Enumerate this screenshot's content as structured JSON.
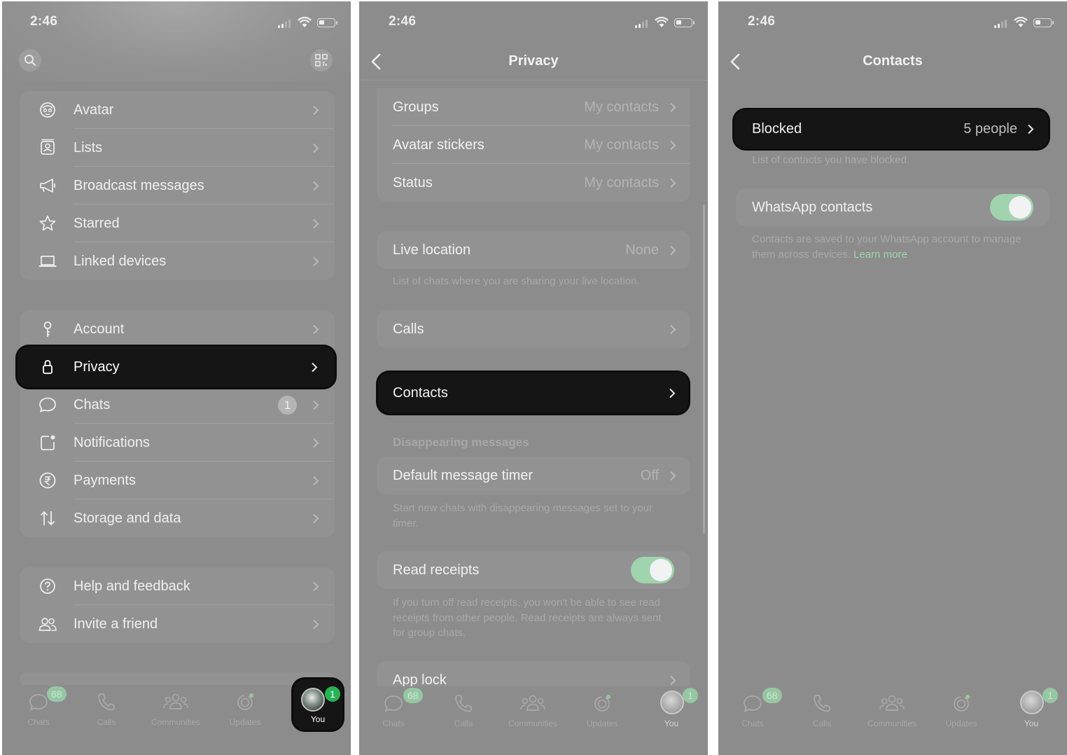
{
  "status_time": "2:46",
  "panel1": {
    "menu_group1": [
      {
        "label": "Avatar",
        "icon": "avatar-face-icon"
      },
      {
        "label": "Lists",
        "icon": "lists-icon"
      },
      {
        "label": "Broadcast messages",
        "icon": "megaphone-icon"
      },
      {
        "label": "Starred",
        "icon": "star-icon"
      },
      {
        "label": "Linked devices",
        "icon": "laptop-icon"
      }
    ],
    "menu_group2": [
      {
        "label": "Account",
        "icon": "key-icon"
      },
      {
        "label": "Privacy",
        "icon": "lock-icon"
      },
      {
        "label": "Chats",
        "icon": "chat-bubble-icon",
        "badge": "1"
      },
      {
        "label": "Notifications",
        "icon": "notification-icon"
      },
      {
        "label": "Payments",
        "icon": "rupee-icon"
      },
      {
        "label": "Storage and data",
        "icon": "transfer-arrows-icon"
      }
    ],
    "menu_group3": [
      {
        "label": "Help and feedback",
        "icon": "help-icon"
      },
      {
        "label": "Invite a friend",
        "icon": "people-icon"
      }
    ]
  },
  "panel2": {
    "title": "Privacy",
    "rows_top": [
      {
        "label": "Groups",
        "value": "My contacts"
      },
      {
        "label": "Avatar stickers",
        "value": "My contacts"
      },
      {
        "label": "Status",
        "value": "My contacts"
      }
    ],
    "live_location": {
      "label": "Live location",
      "value": "None",
      "note": "List of chats where you are sharing your live location."
    },
    "calls": {
      "label": "Calls"
    },
    "contacts": {
      "label": "Contacts"
    },
    "disappearing": {
      "heading": "Disappearing messages",
      "label": "Default message timer",
      "value": "Off",
      "note": "Start new chats with disappearing messages set to your timer."
    },
    "read_receipts": {
      "label": "Read receipts",
      "enabled": true,
      "note": "If you turn off read receipts, you won't be able to see read receipts from other people. Read receipts are always sent for group chats."
    },
    "app_lock": {
      "label": "App lock"
    }
  },
  "panel3": {
    "title": "Contacts",
    "blocked": {
      "label": "Blocked",
      "value": "5 people",
      "note": "List of contacts you have blocked."
    },
    "whatsapp_contacts": {
      "label": "WhatsApp contacts",
      "enabled": true,
      "note": "Contacts are saved to your WhatsApp account to manage them across devices.",
      "link": "Learn more"
    }
  },
  "tabbar": {
    "chats": {
      "label": "Chats",
      "badge": "68"
    },
    "calls": {
      "label": "Calls"
    },
    "communities": {
      "label": "Communities"
    },
    "updates": {
      "label": "Updates"
    },
    "you": {
      "label": "You",
      "badge": "1"
    }
  },
  "colors": {
    "background": "#8c8c8c",
    "highlight": "#151515",
    "whatsapp_green": "#25b554",
    "toggle_on": "#9fd4ae"
  }
}
